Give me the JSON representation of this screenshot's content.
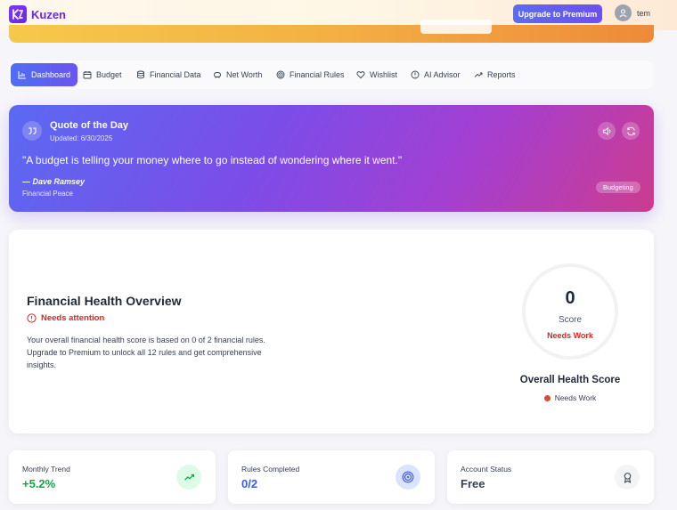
{
  "app": {
    "name": "Kuzen"
  },
  "header": {
    "upgrade_label": "Upgrade to Premium",
    "user_name": "tem"
  },
  "nav": {
    "items": [
      {
        "label": "Dashboard",
        "icon": "bar-chart-icon",
        "active": true
      },
      {
        "label": "Budget",
        "icon": "calendar-icon"
      },
      {
        "label": "Financial Data",
        "icon": "database-icon"
      },
      {
        "label": "Net Worth",
        "icon": "piggy-bank-icon"
      },
      {
        "label": "Financial Rules",
        "icon": "target-icon"
      },
      {
        "label": "Wishlist",
        "icon": "heart-icon"
      },
      {
        "label": "AI Advisor",
        "icon": "ai-icon"
      },
      {
        "label": "Reports",
        "icon": "trend-up-icon"
      }
    ]
  },
  "quote": {
    "title": "Quote of the Day",
    "updated": "Updated: 6/30/2025",
    "text": "\"A budget is telling your money where to go instead of wondering where it went.\"",
    "author": "— Dave Ramsey",
    "source": "Financial Peace",
    "tag": "Budgeting"
  },
  "health": {
    "title": "Financial Health Overview",
    "status": "Needs attention",
    "description": "Your overall financial health score is based on 0 of 2 financial rules. Upgrade to Premium to unlock all 12 rules and get comprehensive insights.",
    "score": "0",
    "score_label": "Score",
    "score_grade": "Needs Work",
    "overall_title": "Overall Health Score",
    "overall_status": "Needs Work"
  },
  "stats": [
    {
      "label": "Monthly Trend",
      "value": "+5.2%",
      "icon": "trend-up-icon",
      "color": "#16a34a"
    },
    {
      "label": "Rules Completed",
      "value": "0/2",
      "icon": "target-icon",
      "color": "#3b5bdb"
    },
    {
      "label": "Account Status",
      "value": "Free",
      "icon": "award-icon",
      "color": "#374151"
    }
  ]
}
